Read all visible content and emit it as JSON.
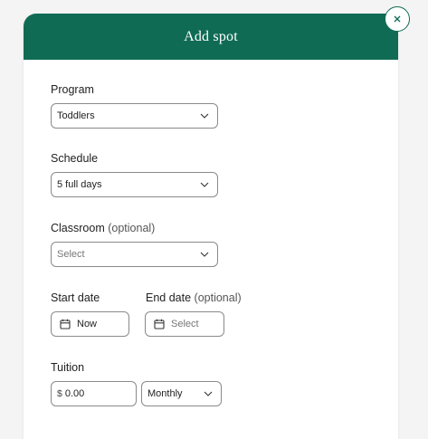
{
  "modal": {
    "title": "Add spot",
    "close_icon": "close-icon"
  },
  "form": {
    "program": {
      "label": "Program",
      "value": "Toddlers"
    },
    "schedule": {
      "label": "Schedule",
      "value": "5 full days"
    },
    "classroom": {
      "label": "Classroom",
      "optional": "(optional)",
      "placeholder": "Select"
    },
    "start_date": {
      "label": "Start date",
      "value": "Now",
      "icon": "calendar-icon"
    },
    "end_date": {
      "label": "End date",
      "optional": "(optional)",
      "placeholder": "Select",
      "icon": "calendar-icon"
    },
    "tuition": {
      "label": "Tuition",
      "currency": "$",
      "amount": "0.00",
      "frequency": "Monthly"
    }
  },
  "colors": {
    "header": "#106b55",
    "background": "#f4f4f4",
    "border": "#8a8a8a"
  }
}
